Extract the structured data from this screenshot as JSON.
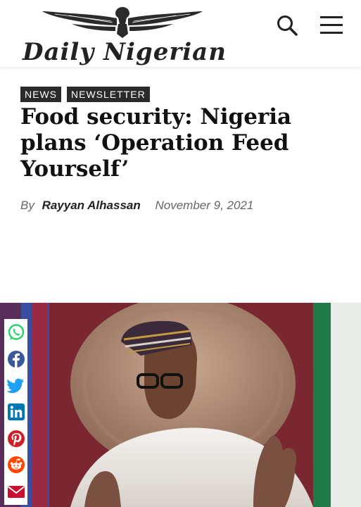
{
  "header": {
    "brand_name": "Daily Nigerian",
    "icons": {
      "search": "search-icon",
      "menu": "hamburger-menu-icon"
    }
  },
  "article": {
    "categories": [
      "NEWS",
      "NEWSLETTER"
    ],
    "title": "Food security: Nigeria plans ‘Operation Feed Yourself’",
    "byline_prefix": "By",
    "author": "Rayyan Alhassan",
    "date": "November 9, 2021"
  },
  "share": {
    "icons": [
      "whatsapp-icon",
      "facebook-icon",
      "twitter-icon",
      "linkedin-icon",
      "pinterest-icon",
      "reddit-icon",
      "email-icon"
    ]
  },
  "colors": {
    "tag_bg": "#2a2a2a",
    "whatsapp": "#25D366",
    "facebook": "#3b5998",
    "twitter": "#1da1f2",
    "linkedin": "#0077b5",
    "pinterest": "#cb2027",
    "reddit": "#ff4500",
    "email": "#c8102e"
  }
}
